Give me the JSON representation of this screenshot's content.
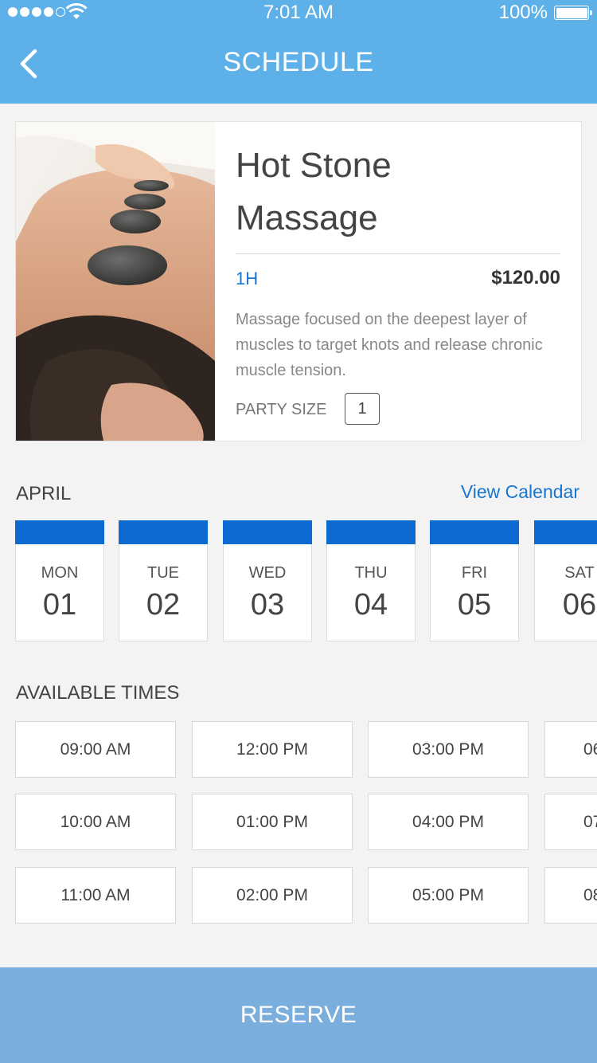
{
  "status_bar": {
    "time": "7:01 AM",
    "battery": "100%"
  },
  "header": {
    "title": "SCHEDULE"
  },
  "service": {
    "name_line1": "Hot Stone",
    "name_line2": "Massage",
    "duration": "1H",
    "price": "$120.00",
    "description": "Massage focused on the deepest layer of muscles to target knots and release chronic muscle tension.",
    "party_size_label": "PARTY SIZE",
    "party_size_value": "1"
  },
  "calendar": {
    "month": "APRIL",
    "view_calendar_label": "View Calendar",
    "days": [
      {
        "dow": "MON",
        "num": "01"
      },
      {
        "dow": "TUE",
        "num": "02"
      },
      {
        "dow": "WED",
        "num": "03"
      },
      {
        "dow": "THU",
        "num": "04"
      },
      {
        "dow": "FRI",
        "num": "05"
      },
      {
        "dow": "SAT",
        "num": "06"
      }
    ]
  },
  "times": {
    "heading": "AVAILABLE TIMES",
    "slots": [
      "09:00 AM",
      "12:00 PM",
      "03:00 PM",
      "06",
      "10:00 AM",
      "01:00 PM",
      "04:00 PM",
      "07",
      "11:00 AM",
      "02:00 PM",
      "05:00 PM",
      "08"
    ]
  },
  "footer": {
    "reserve_label": "RESERVE"
  },
  "colors": {
    "header": "#5eb0e9",
    "accent": "#1976d2",
    "day_cap": "#0c6ad0",
    "reserve": "#7aaedc"
  }
}
